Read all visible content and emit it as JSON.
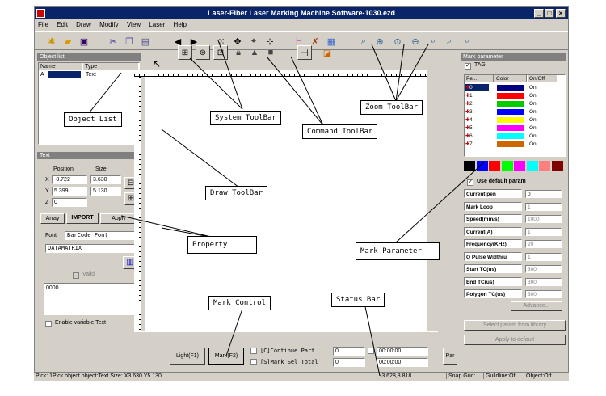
{
  "window": {
    "title": "Laser-Fiber Laser Marking Machine Software-1030.ezd",
    "min": "_",
    "max": "□",
    "close": "×"
  },
  "menu": [
    "File",
    "Edit",
    "Draw",
    "Modify",
    "View",
    "Laser",
    "Help"
  ],
  "object_list": {
    "title": "Object list",
    "col_name": "Name",
    "col_type": "Type",
    "row_name": "A",
    "row_type": "Text"
  },
  "text_panel": {
    "title": "Text",
    "position_label": "Position",
    "size_label": "Size",
    "x_label": "X",
    "y_label": "Y",
    "z_label": "Z",
    "x_pos": "-8.722",
    "y_pos": "5.399",
    "z_pos": "0",
    "x_size": "3.630",
    "y_size": "5.130",
    "tab_array": "Array",
    "tab_import": "IMPORT",
    "tab_apply": "Apply",
    "font_label": "Font",
    "font_value": "BarCode Font",
    "barcode_value": "DATAMATRIX",
    "valid_label": "Valid",
    "text_value": "0000",
    "enable_variable": "Enable variable Text"
  },
  "mark_param": {
    "title": "Mark parameter",
    "tag_label": "TAG",
    "col_pe": "Pe...",
    "col_color": "Color",
    "col_onoff": "On/Off",
    "pens": [
      {
        "n": "0",
        "color": "#000080",
        "state": "On"
      },
      {
        "n": "1",
        "color": "#ff0000",
        "state": "On"
      },
      {
        "n": "2",
        "color": "#00cc00",
        "state": "On"
      },
      {
        "n": "3",
        "color": "#0000ff",
        "state": "On"
      },
      {
        "n": "4",
        "color": "#ffff00",
        "state": "On"
      },
      {
        "n": "5",
        "color": "#ff00ff",
        "state": "On"
      },
      {
        "n": "6",
        "color": "#00ffff",
        "state": "On"
      },
      {
        "n": "7",
        "color": "#cc6600",
        "state": "On"
      }
    ],
    "palette": [
      "#000000",
      "#0000ff",
      "#ff0000",
      "#00ff00",
      "#ff00ff",
      "#00ffff",
      "#ff8080",
      "#800000"
    ],
    "use_default": "Use default param",
    "params": [
      {
        "label": "Current pen",
        "value": "0"
      },
      {
        "label": "Mark Loop",
        "value": "1"
      },
      {
        "label": "Speed(mm/s)",
        "value": "1000"
      },
      {
        "label": "Current(A)",
        "value": "1"
      },
      {
        "label": "Frequency(KHz)",
        "value": "20"
      },
      {
        "label": "Q Pulse Width(u",
        "value": "1"
      },
      {
        "label": "Start TC(us)",
        "value": "300"
      },
      {
        "label": "End TC(us)",
        "value": "300"
      },
      {
        "label": "Polygon TC(us)",
        "value": "300"
      }
    ],
    "advance": "Advance...",
    "select_library": "Select param from library",
    "apply_default": "Apply to default"
  },
  "bottom": {
    "light": "Light(F1)",
    "mark": "Mark(F2)",
    "continue": "[C]Continue Part",
    "mark_sel": "[S]Mark Sel Total",
    "part_val": "0",
    "total_val": "0",
    "time1": "00:00:00",
    "time2": "00:00:00",
    "par": "Par"
  },
  "statusbar": {
    "left": "Pick: 1Pick object object:Text Size: X3.630 Y5.130",
    "coords": "-3.628,8.818",
    "snap": "Snap Grid:",
    "guideline": "Guildline:Of",
    "object": "Object:Off"
  },
  "callouts": {
    "object_list": "Object List",
    "system_toolbar": "System ToolBar",
    "command_toolbar": "Command ToolBar",
    "zoom_toolbar": "Zoom ToolBar",
    "draw_toolbar": "Draw ToolBar",
    "property": "Property",
    "mark_parameter": "Mark Parameter",
    "mark_control": "Mark Control",
    "status_bar": "Status Bar"
  }
}
